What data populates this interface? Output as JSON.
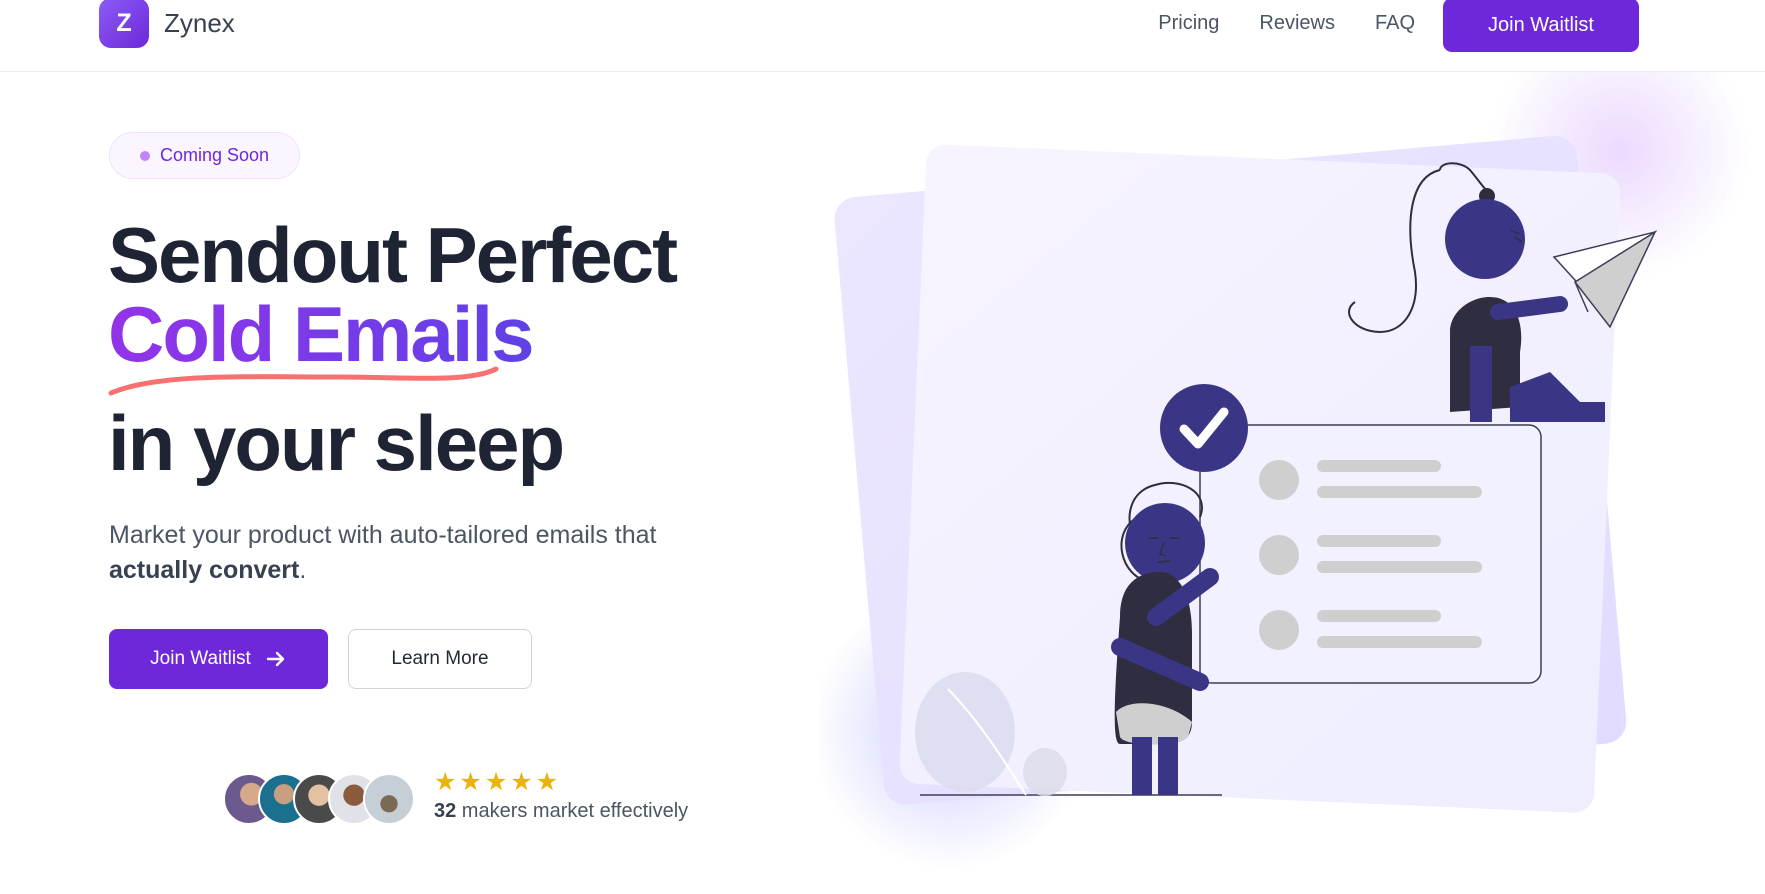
{
  "brand": {
    "logo_letter": "Z",
    "name": "Zynex"
  },
  "nav": {
    "links": [
      "Pricing",
      "Reviews",
      "FAQ"
    ],
    "cta_label": "Join Waitlist"
  },
  "hero": {
    "badge": "Coming Soon",
    "headline_line1": "Sendout Perfect",
    "headline_highlight": "Cold Emails",
    "headline_line3": "in your sleep",
    "subtext_prefix": "Market your product with auto-tailored emails that ",
    "subtext_bold": "actually convert",
    "subtext_suffix": ".",
    "primary_button": "Join Waitlist",
    "secondary_button": "Learn More"
  },
  "social_proof": {
    "rating_stars": 5,
    "count": "32",
    "text": " makers market effectively"
  },
  "colors": {
    "accent": "#6d28d9",
    "gradient_start": "#9333ea",
    "gradient_end": "#4f46e5",
    "squiggle": "#f87171",
    "star": "#eab308",
    "illustration_primary": "#3b3586",
    "illustration_dark": "#2f2e41"
  }
}
